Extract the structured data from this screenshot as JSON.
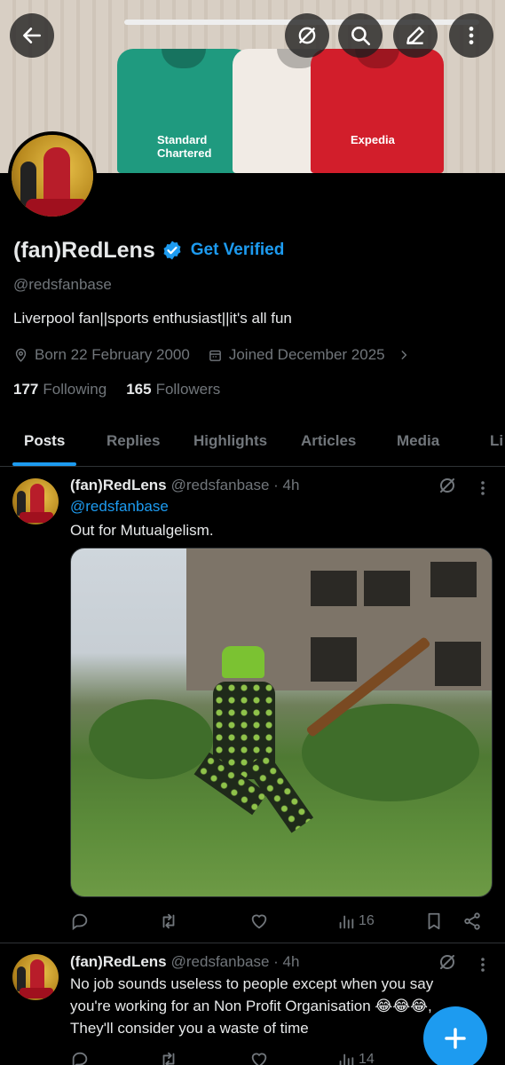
{
  "profile": {
    "name": "(fan)RedLens",
    "get_verified": "Get Verified",
    "handle": "@redsfanbase",
    "bio": "Liverpool fan||sports enthusiast||it's all fun",
    "born": "Born 22 February 2000",
    "joined": "Joined December 2025",
    "following_count": "177",
    "following_label": "Following",
    "followers_count": "165",
    "followers_label": "Followers"
  },
  "banner": {
    "sponsor_1": "Standard Chartered",
    "sponsor_2": "Expedia"
  },
  "tabs": [
    {
      "label": "Posts"
    },
    {
      "label": "Replies"
    },
    {
      "label": "Highlights"
    },
    {
      "label": "Articles"
    },
    {
      "label": "Media"
    },
    {
      "label": "Li"
    }
  ],
  "posts": [
    {
      "name": "(fan)RedLens",
      "handle_time": "@redsfanbase · 4h",
      "mention": "@redsfanbase",
      "text": "Out for Mutualgelism.",
      "views": "16"
    },
    {
      "name": "(fan)RedLens",
      "handle_time": "@redsfanbase · 4h",
      "line1": "No job sounds useless to people except when you say",
      "line2": "you're working for an Non Profit Organisation 😂😂😂,",
      "line3": "They'll consider you a waste of time",
      "views": "14"
    }
  ],
  "colors": {
    "accent": "#1d9bf0",
    "background": "#000000",
    "secondary_text": "#71767b"
  }
}
